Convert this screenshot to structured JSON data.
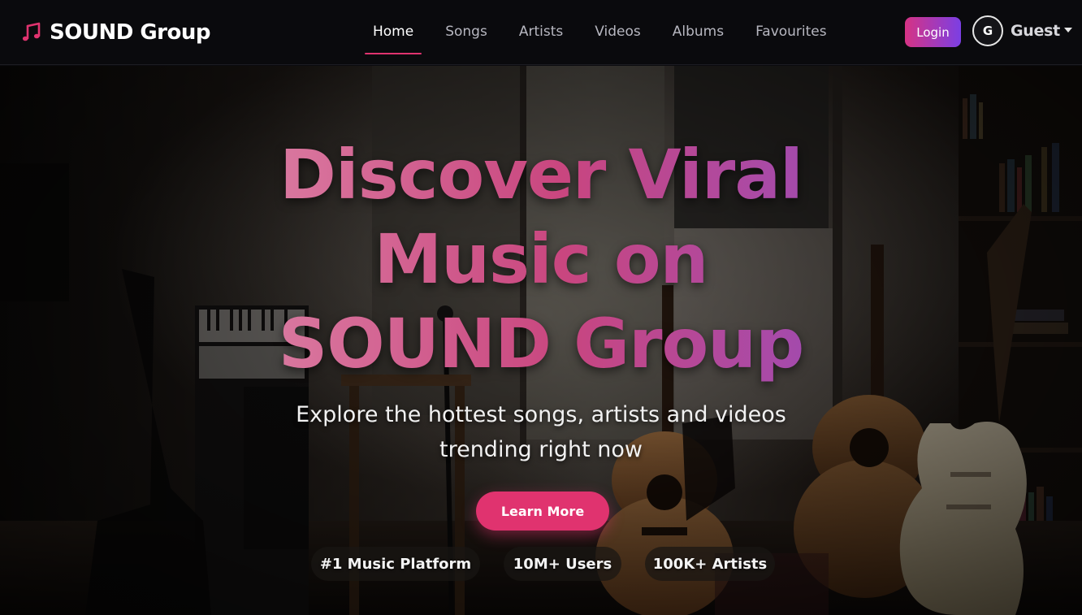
{
  "brand": {
    "name": "SOUND Group",
    "icon": "music-note-icon",
    "accent": "#e0336f"
  },
  "nav": {
    "links": [
      {
        "label": "Home",
        "active": true
      },
      {
        "label": "Songs",
        "active": false
      },
      {
        "label": "Artists",
        "active": false
      },
      {
        "label": "Videos",
        "active": false
      },
      {
        "label": "Albums",
        "active": false
      },
      {
        "label": "Favourites",
        "active": false
      }
    ],
    "login_label": "Login",
    "user": {
      "avatar_letter": "G",
      "name": "Guest"
    }
  },
  "hero": {
    "title_lines": [
      "Discover Viral",
      "Music on",
      "SOUND Group"
    ],
    "subtitle_lines": [
      "Explore the hottest songs, artists and videos",
      "trending right now"
    ],
    "cta_label": "Learn More",
    "stats": [
      "#1 Music Platform",
      "10M+ Users",
      "100K+ Artists"
    ]
  },
  "colors": {
    "accent": "#e0336f",
    "login_gradient_start": "#d63384",
    "login_gradient_end": "#7b3fe4",
    "navbar_bg": "#0a0a0d"
  }
}
